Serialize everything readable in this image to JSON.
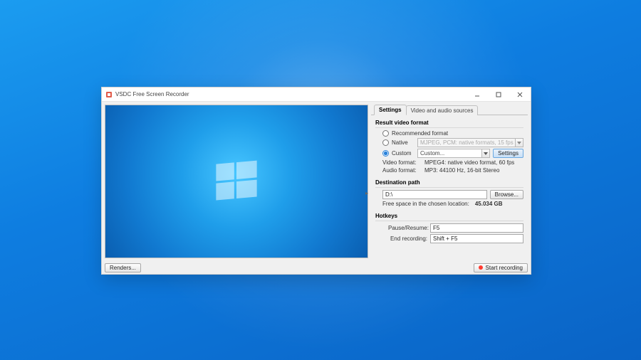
{
  "window": {
    "title": "VSDC Free Screen Recorder"
  },
  "tabs": {
    "settings": "Settings",
    "sources": "Video and audio sources"
  },
  "sections": {
    "result_format": "Result video format",
    "destination": "Destination path",
    "hotkeys": "Hotkeys"
  },
  "format": {
    "recommended_label": "Recommended format",
    "native_label": "Native",
    "native_value": "MJPEG, PCM: native formats, 15 fps",
    "custom_label": "Custom",
    "custom_value": "Custom...",
    "settings_btn": "Settings",
    "video_fmt_k": "Video format:",
    "video_fmt_v": "MPEG4: native video format, 60 fps",
    "audio_fmt_k": "Audio format:",
    "audio_fmt_v": "MP3: 44100 Hz, 16-bit Stereo"
  },
  "destination": {
    "path": "D:\\",
    "browse_btn": "Browse...",
    "free_space_k": "Free space in the chosen location:",
    "free_space_v": "45.034 GB"
  },
  "hotkeys": {
    "pause_k": "Pause/Resume:",
    "pause_v": "F5",
    "end_k": "End recording:",
    "end_v": "Shift + F5"
  },
  "footer": {
    "renders_btn": "Renders...",
    "start_btn": "Start recording"
  }
}
